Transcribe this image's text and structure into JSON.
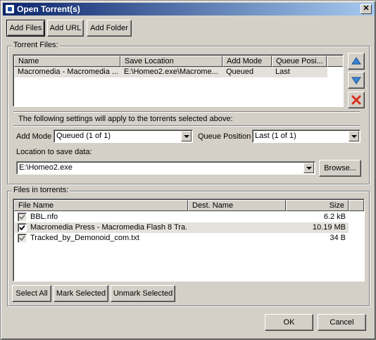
{
  "window": {
    "title": "Open Torrent(s)",
    "close_glyph": "✕"
  },
  "toolbar": {
    "add_files": "Add Files",
    "add_url": "Add URL",
    "add_folder": "Add Folder"
  },
  "torrent_files": {
    "legend": "Torrent Files:",
    "columns": [
      "Name",
      "Save Location",
      "Add Mode",
      "Queue Posi..."
    ],
    "rows": [
      {
        "name": "Macromedia - Macromedia ...",
        "save_location": "E:\\Homeo2.exe\\Macrome...",
        "add_mode": "Queued",
        "queue_position": "Last"
      }
    ],
    "side_buttons": [
      "arrow-up-icon",
      "arrow-down-icon",
      "remove-x-icon"
    ]
  },
  "settings": {
    "note": "The following settings will apply to the torrents selected above:",
    "add_mode_label": "Add Mode",
    "add_mode_value": "Queued (1 of 1)",
    "queue_position_label": "Queue Position",
    "queue_position_value": "Last (1 of 1)",
    "location_label": "Location to save data:",
    "location_value": "E:\\Homeo2.exe",
    "browse": "Browse..."
  },
  "files_in_torrents": {
    "legend": "Files in torrents:",
    "columns": [
      "File Name",
      "Dest. Name",
      "Size"
    ],
    "rows": [
      {
        "name": "BBL.nfo",
        "dest": "",
        "size": "6.2 kB",
        "checked": true
      },
      {
        "name": "Macromedia Press - Macromedia Flash 8 Tra...",
        "dest": "",
        "size": "10.19 MB",
        "checked": true
      },
      {
        "name": "Tracked_by_Demonoid_com.txt",
        "dest": "",
        "size": "34 B",
        "checked": true
      }
    ],
    "select_all": "Select All",
    "mark_selected": "Mark Selected",
    "unmark_selected": "Unmark Selected"
  },
  "footer": {
    "ok": "OK",
    "cancel": "Cancel"
  },
  "colors": {
    "title_start": "#0a246a",
    "title_end": "#a6caf0",
    "face": "#d4d0c8",
    "up_down_arrow": "#3a86d6",
    "remove_x": "#d9301e"
  }
}
